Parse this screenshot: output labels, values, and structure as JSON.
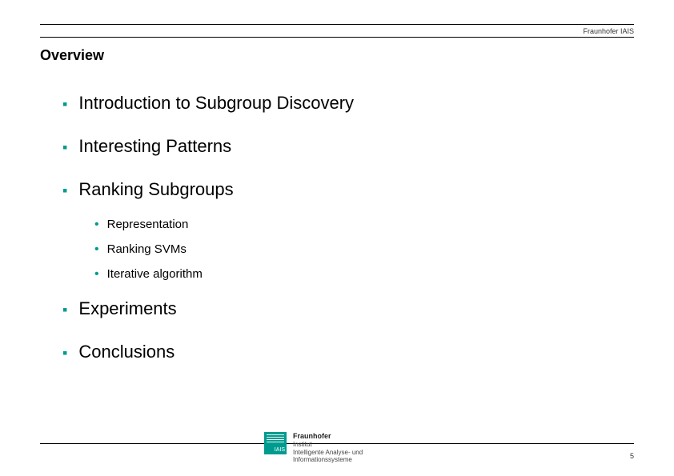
{
  "brand": "Fraunhofer IAIS",
  "title": "Overview",
  "bullets": [
    {
      "text": "Introduction to Subgroup Discovery"
    },
    {
      "text": "Interesting Patterns"
    },
    {
      "text": "Ranking Subgroups",
      "sub": [
        "Representation",
        "Ranking SVMs",
        "Iterative algorithm"
      ]
    },
    {
      "text": "Experiments"
    },
    {
      "text": "Conclusions"
    }
  ],
  "footer": {
    "logo_label": "IAIS",
    "org_name": "Fraunhofer",
    "org_dept_line1": "Institut",
    "org_dept_line2": "Intelligente Analyse- und",
    "org_dept_line3": "Informationssysteme"
  },
  "page_number": "5",
  "colors": {
    "accent": "#009B8F"
  }
}
